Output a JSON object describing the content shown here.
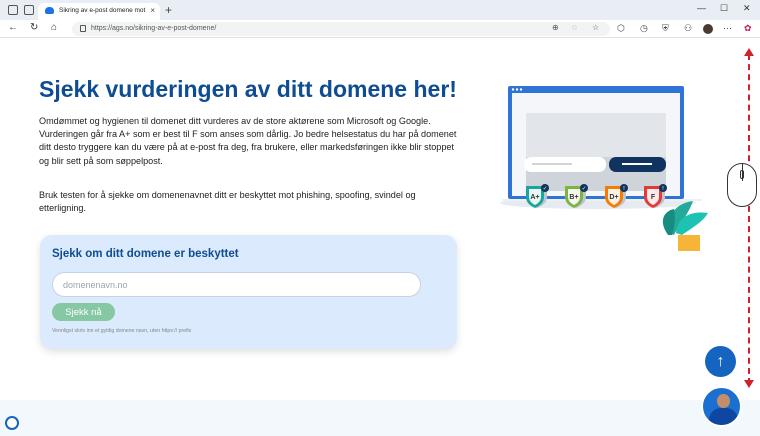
{
  "browser": {
    "tab_title": "Sikring av e-post domene mot ph",
    "tab_close": "×",
    "new_tab": "+",
    "url": "https://ags.no/sikring-av-e-post-domene/",
    "window_min": "—",
    "window_max": "☐",
    "window_close": "✕"
  },
  "page": {
    "title": "Sjekk vurderingen av ditt domene her!",
    "paragraph1": "Omdømmet og hygienen til domenet ditt vurderes av de store aktørene som Microsoft og Google. Vurderingen går fra A+ som er best til F som anses som dårlig. Jo bedre helsestatus du har på domenet ditt desto tryggere kan du være på at e-post fra deg, fra brukere, eller markedsføringen ikke blir stoppet og blir sett på som søppelpost.",
    "paragraph2": "Bruk testen for å sjekke om domenenavnet ditt er beskyttet mot phishing, spoofing, svindel og etterligning."
  },
  "form": {
    "heading": "Sjekk om ditt domene er beskyttet",
    "placeholder": "domenenavn.no",
    "button_label": "Sjekk nå",
    "hint": "Vennligst skriv inn et gyldig domene navn, uten https:// prefix"
  },
  "grades": [
    {
      "label": "A+",
      "color": "#1aa79a",
      "status": "check"
    },
    {
      "label": "B+",
      "color": "#7cb342",
      "status": "check"
    },
    {
      "label": "D+",
      "color": "#f57c00",
      "status": "warning"
    },
    {
      "label": "F",
      "color": "#e53935",
      "status": "warning"
    }
  ],
  "colors": {
    "title": "#0e4d92",
    "card_bg": "#dbeafc",
    "button": "#86c7a4",
    "scroll_indicator": "#d0202a",
    "top_button": "#1565c0"
  },
  "widgets": {
    "back_to_top": "↑"
  }
}
